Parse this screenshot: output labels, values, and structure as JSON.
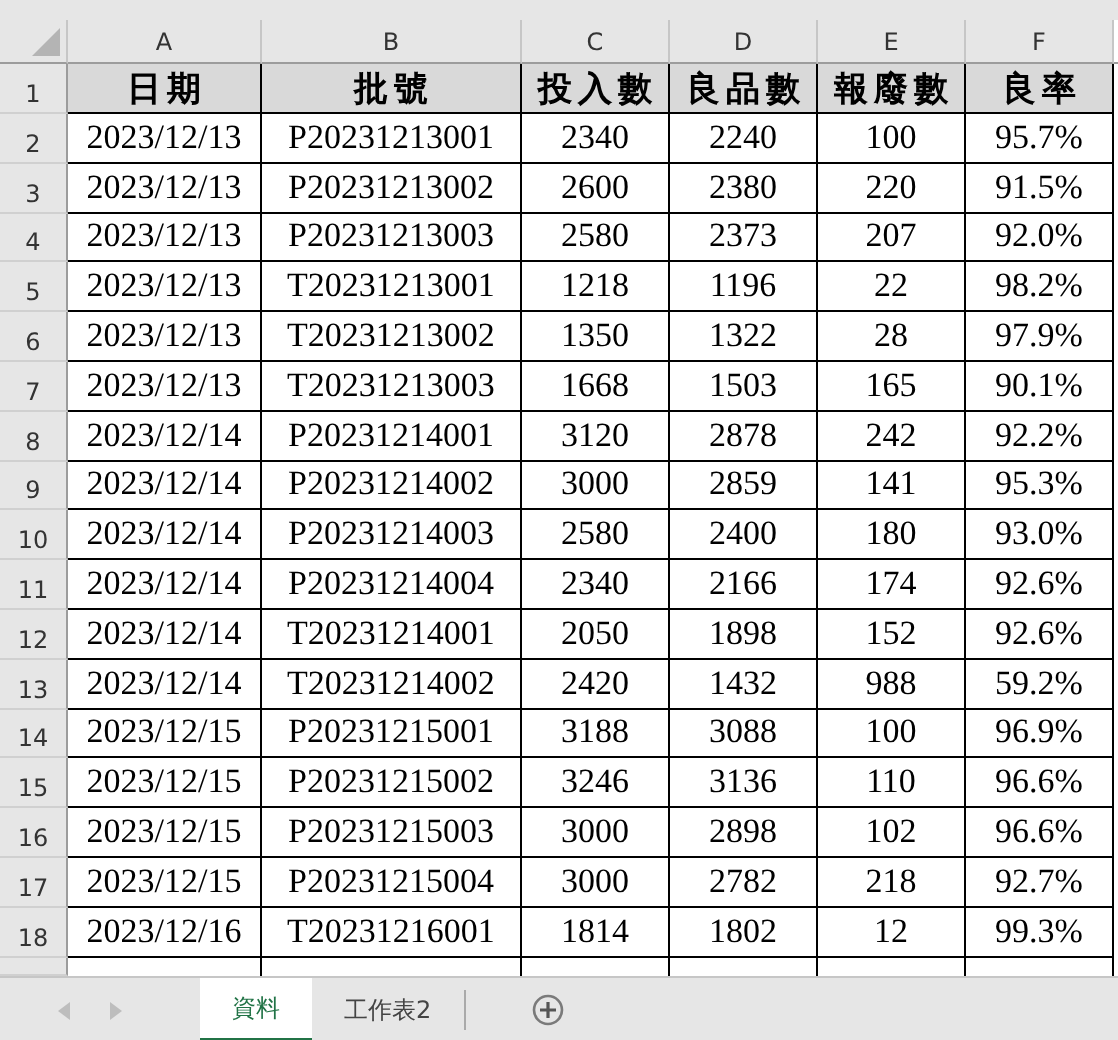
{
  "column_headers": [
    "A",
    "B",
    "C",
    "D",
    "E",
    "F"
  ],
  "table": {
    "columns": [
      "日期",
      "批號",
      "投入數",
      "良品數",
      "報廢數",
      "良率"
    ],
    "rows": [
      [
        "2023/12/13",
        "P20231213001",
        "2340",
        "2240",
        "100",
        "95.7%"
      ],
      [
        "2023/12/13",
        "P20231213002",
        "2600",
        "2380",
        "220",
        "91.5%"
      ],
      [
        "2023/12/13",
        "P20231213003",
        "2580",
        "2373",
        "207",
        "92.0%"
      ],
      [
        "2023/12/13",
        "T20231213001",
        "1218",
        "1196",
        "22",
        "98.2%"
      ],
      [
        "2023/12/13",
        "T20231213002",
        "1350",
        "1322",
        "28",
        "97.9%"
      ],
      [
        "2023/12/13",
        "T20231213003",
        "1668",
        "1503",
        "165",
        "90.1%"
      ],
      [
        "2023/12/14",
        "P20231214001",
        "3120",
        "2878",
        "242",
        "92.2%"
      ],
      [
        "2023/12/14",
        "P20231214002",
        "3000",
        "2859",
        "141",
        "95.3%"
      ],
      [
        "2023/12/14",
        "P20231214003",
        "2580",
        "2400",
        "180",
        "93.0%"
      ],
      [
        "2023/12/14",
        "P20231214004",
        "2340",
        "2166",
        "174",
        "92.6%"
      ],
      [
        "2023/12/14",
        "T20231214001",
        "2050",
        "1898",
        "152",
        "92.6%"
      ],
      [
        "2023/12/14",
        "T20231214002",
        "2420",
        "1432",
        "988",
        "59.2%"
      ],
      [
        "2023/12/15",
        "P20231215001",
        "3188",
        "3088",
        "100",
        "96.9%"
      ],
      [
        "2023/12/15",
        "P20231215002",
        "3246",
        "3136",
        "110",
        "96.6%"
      ],
      [
        "2023/12/15",
        "P20231215003",
        "3000",
        "2898",
        "102",
        "96.6%"
      ],
      [
        "2023/12/15",
        "P20231215004",
        "3000",
        "2782",
        "218",
        "92.7%"
      ],
      [
        "2023/12/16",
        "T20231216001",
        "1814",
        "1802",
        "12",
        "99.3%"
      ]
    ]
  },
  "row_numbers": [
    "1",
    "2",
    "3",
    "4",
    "5",
    "6",
    "7",
    "8",
    "9",
    "10",
    "11",
    "12",
    "13",
    "14",
    "15",
    "16",
    "17",
    "18"
  ],
  "sheet_tabs": [
    {
      "label": "資料",
      "selected": true
    },
    {
      "label": "工作表2",
      "selected": false
    }
  ]
}
